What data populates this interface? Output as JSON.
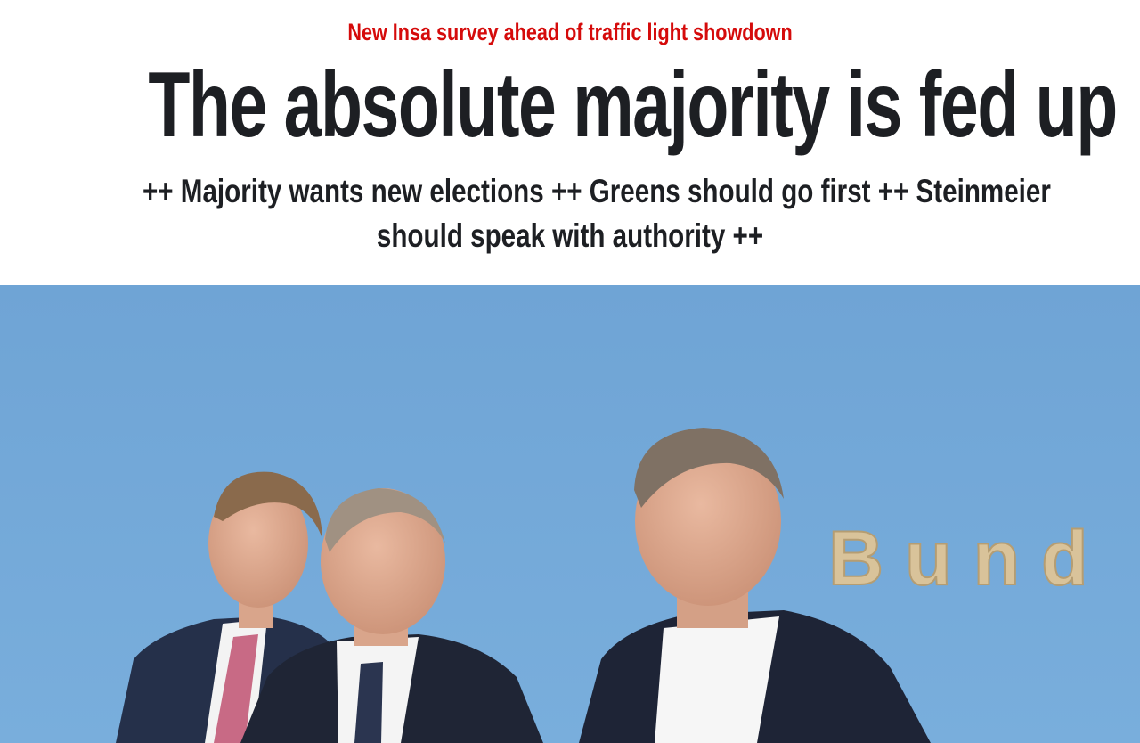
{
  "article": {
    "kicker": "New Insa survey ahead of traffic light showdown",
    "headline": "The absolute majority is fed up",
    "subline_line1": "++ Majority wants new elections ++ Greens should go first ++ Steinmeier",
    "subline_line2": "should speak with authority ++"
  },
  "photo": {
    "wall_lettering": "Bund"
  },
  "colors": {
    "kicker": "#d50b0b",
    "headline": "#1d1f23",
    "background": "#ffffff",
    "photo_wall": "#72a7d8"
  }
}
